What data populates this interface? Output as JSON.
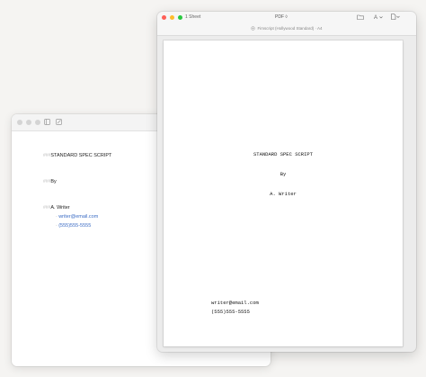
{
  "editor": {
    "lines": [
      {
        "tag": "###",
        "text": "STANDARD SPEC SCRIPT"
      },
      {
        "tag": "###",
        "text": "By"
      },
      {
        "tag": "###",
        "text": "A. Writer"
      }
    ],
    "contact": [
      {
        "bullet": "-",
        "text": "writer@email.com"
      },
      {
        "bullet": "-",
        "text": "(555)555-5555"
      }
    ]
  },
  "preview": {
    "sheets": "1 Sheet",
    "format": "PDF ◊",
    "subtitle": "Fimscript (Hollywood Standard) · A4",
    "page": {
      "title": "STANDARD SPEC SCRIPT",
      "by": "By",
      "author": "A. Writer",
      "email": "writer@email.com",
      "phone": "(555)555-5555"
    }
  }
}
